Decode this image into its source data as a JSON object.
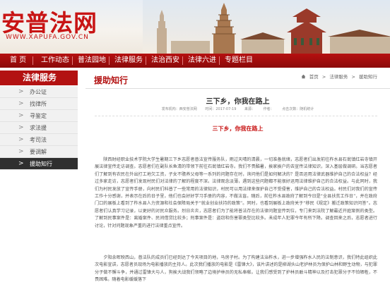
{
  "banner": {
    "logo_text": "安普法网",
    "logo_url": "WWW.XAPUFA.GOV.CN",
    "accent_color": "#c81414"
  },
  "nav": {
    "items": [
      "首 页",
      "工作动态",
      "普法园地",
      "法律服务",
      "法治西安",
      "法律六进",
      "专题栏目"
    ]
  },
  "sidebar": {
    "title": "法律服务",
    "items": [
      {
        "label": "办公证"
      },
      {
        "label": "找律所"
      },
      {
        "label": "寻鉴定"
      },
      {
        "label": "求法援"
      },
      {
        "label": "考司法"
      },
      {
        "label": "要调解"
      },
      {
        "label": "援助知行",
        "active": true
      }
    ]
  },
  "main": {
    "section_title": "援助知行",
    "breadcrumb": [
      "首页",
      "法律服务",
      "援助知行"
    ],
    "article": {
      "title": "三下乡，你我在路上",
      "meta": [
        "发布机构：西安普法网",
        "时间：2017-07-19",
        "来源：",
        "作者：",
        "点击次数：随机统计"
      ],
      "headline": "三下乡，你我在路上",
      "paragraphs": [
        "陕西财经职业技术学院大学生暑期三下乡志愿者普法宣传服务队，雨过天晴的清晨，一切准备就绪，志愿者们出发前往柞水县石瓮镇红岩寺镇开展法律宣传走访调查。志愿者们在副队长鱼清的带领下前往石瓮镇红岩寺。我们不畏酷暑，挨家挨户的去宣传法律知识，深入基层做调研。当志愿者们了解到有农民在外出打工地欠工资，子女不赡养父母等一系列的问题存在时，询问他们是如何解决的？是否运用法律武器维护自己的合法权益？经过多家走访，志愿者们发现村民们对法律的了解的程度不深。法律观念淡薄，遇到这些问题都不能很好运用法律维护自己的合法权益。与此同时，我们为村民发放了宣传手册，向村民们科普了一些常用的法律知识，村民可以用法律来保护自己不受侵害，维护自己的合法权益。村民们对我们的宣传工作十分感谢，并表示在后的日子里，他们也会好好学习手册的内容，不做法盲。随后，前往柞水县政府了解到今日是“全县扶贫工作日”，并在政府门口的展板上看到了柞水县人力资源和社会保障局关于“就业创业扶持的政策”。同时，也看到展板上政府关于“移民《规定》搬迁政策知识问答”。志愿者们认真学习记录，以更好的对民众服务。烈日炎炎，志愿者们为了能将普法存在的法律问题宣传到位，专门来到法院了解最近开庭案例的类型。了解到民事案件是：离婚案件、民间借贷比较多；刑事案件是：盗窃和伤害罪类型比较多。未成年人犯罪今年有所下降。调查回来之后，志愿者进行讨论，针对问题现象严重的进行法律重点宣传。",
        "夕阳余晖映西山，普法队的成员们已经到达了今天项目的地，马房子村。为了构建法治柞水，进一步增强柞水人民的法制意识，我们特此组织此次电影宣讲，志愿者员现场为电影播放的主持人。此次我们播放的电影是《雷锋大》，该片讲述的是柳湖头山老护林员为保护山林和野生动物，与犯罪分子做不懈斗争，并通过雷锋大与人，狗挨大战我们领略了边境护林员的无私奉献。让我们感受到了护林员敢斗精神以及打击犯罪分子不怕牺牲，不畏困难。随着电影缓缓落下"
      ]
    }
  }
}
